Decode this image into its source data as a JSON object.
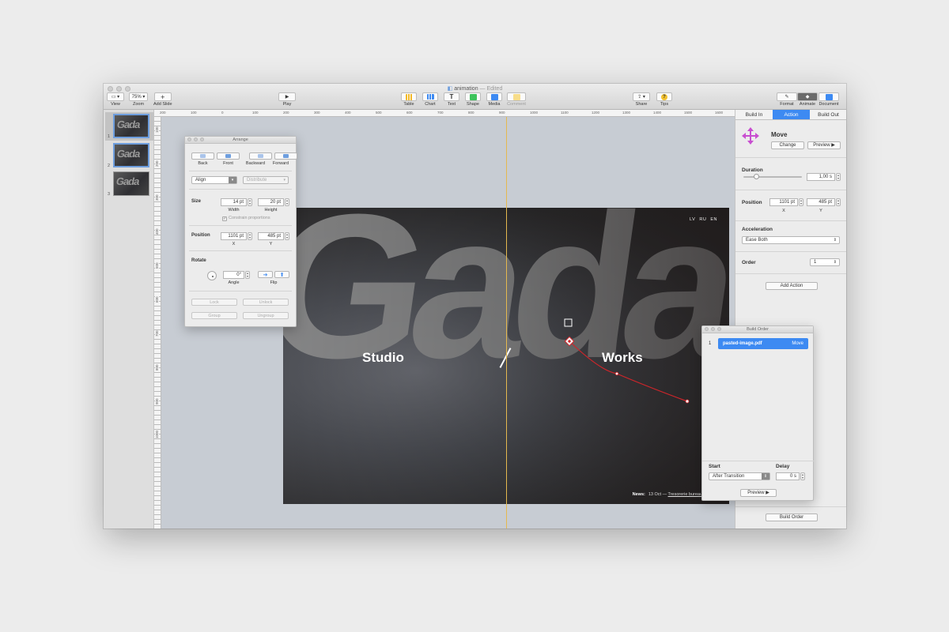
{
  "window": {
    "title": "animation",
    "status": "— Edited"
  },
  "toolbar": {
    "view": "View",
    "zoom_value": "75%",
    "zoom": "Zoom",
    "add_slide": "Add Slide",
    "play": "Play",
    "table": "Table",
    "chart": "Chart",
    "text": "Text",
    "shape": "Shape",
    "media": "Media",
    "comment": "Comment",
    "share": "Share",
    "tips": "Tips",
    "format": "Format",
    "animate": "Animate",
    "document": "Document"
  },
  "slides": {
    "numbers": [
      "1",
      "2",
      "3"
    ]
  },
  "ruler": {
    "marks": [
      "200",
      "100",
      "0",
      "100",
      "200",
      "300",
      "400",
      "500",
      "600",
      "700",
      "800",
      "900",
      "1000",
      "1100",
      "1200",
      "1300",
      "1400",
      "1500",
      "1600"
    ],
    "vmarks": [
      "100",
      "200",
      "300",
      "400",
      "500",
      "600",
      "700",
      "800",
      "900",
      "1000"
    ]
  },
  "slide": {
    "studio": "Studio",
    "works": "Works",
    "langs": "LV  RU  EN",
    "news_label": "News:",
    "news_date": "13 Oct — ",
    "news_link": "Tresorerie bureau identity",
    "bg_letters": "Gada"
  },
  "arrange": {
    "title": "Arrange",
    "back": "Back",
    "front": "Front",
    "backward": "Backward",
    "forward": "Forward",
    "align": "Align",
    "distribute": "Distribute",
    "size_label": "Size",
    "width_value": "14 pt",
    "height_value": "20 pt",
    "width": "Width",
    "height": "Height",
    "constrain": "Constrain proportions",
    "position_label": "Position",
    "x_value": "1101 pt",
    "y_value": "485 pt",
    "x": "X",
    "y": "Y",
    "rotate_label": "Rotate",
    "angle_value": "0°",
    "angle": "Angle",
    "flip": "Flip",
    "lock": "Lock",
    "unlock": "Unlock",
    "group": "Group",
    "ungroup": "Ungroup"
  },
  "inspector": {
    "tabs": [
      "Build In",
      "Action",
      "Build Out"
    ],
    "effect": "Move",
    "change": "Change",
    "preview": "Preview ▶",
    "duration_label": "Duration",
    "duration_value": "1,00 s",
    "position_label": "Position",
    "x_value": "1101 pt",
    "y_value": "485 pt",
    "x": "X",
    "y": "Y",
    "acceleration_label": "Acceleration",
    "acceleration_value": "Ease Both",
    "order_label": "Order",
    "order_value": "1",
    "add_action": "Add Action",
    "build_order": "Build Order"
  },
  "build_order": {
    "title": "Build Order",
    "item_num": "1",
    "item_name": "pasted-image.pdf",
    "item_effect": "Move",
    "start_label": "Start",
    "start_value": "After Transition",
    "delay_label": "Delay",
    "delay_value": "0 s",
    "preview": "Preview ▶"
  },
  "colors": {
    "accent": "#3d8af2",
    "guide": "#e5b94f",
    "motion_path": "#d0252a"
  }
}
